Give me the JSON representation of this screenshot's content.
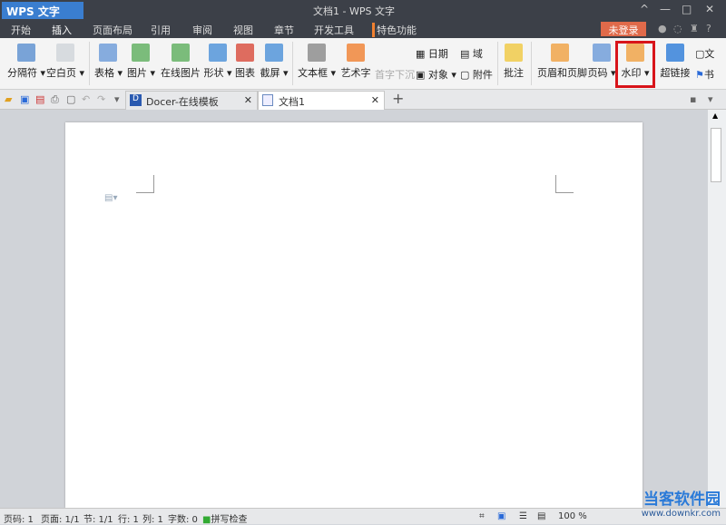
{
  "title_bar": {
    "app_button": "WPS 文字",
    "doc_title": "文档1 - WPS 文字",
    "controls": [
      "^",
      "—",
      "□",
      "✕"
    ]
  },
  "menu": {
    "tabs": [
      "开始",
      "插入",
      "页面布局",
      "引用",
      "审阅",
      "视图",
      "章节",
      "开发工具",
      "特色功能"
    ],
    "active": "插入",
    "login": "未登录",
    "help": "?"
  },
  "ribbon": {
    "large": [
      {
        "label": "分隔符 ▾",
        "color": "#5a8fd0"
      },
      {
        "label": "空白页 ▾",
        "color": "#cfd4da"
      },
      {
        "label": "表格 ▾",
        "color": "#6a9ad8"
      },
      {
        "label": "图片 ▾",
        "color": "#5cae5c"
      },
      {
        "label": "在线图片",
        "color": "#5cae5c"
      },
      {
        "label": "形状 ▾",
        "color": "#4a90d8"
      },
      {
        "label": "图表",
        "color": "#d84a3a"
      },
      {
        "label": "截屏 ▾",
        "color": "#4a90d8"
      },
      {
        "label": "文本框 ▾",
        "color": "#888888"
      },
      {
        "label": "艺术字",
        "color": "#f08030"
      },
      {
        "label": "批注",
        "color": "#f0c840"
      },
      {
        "label": "页眉和页脚",
        "color": "#f0a040"
      },
      {
        "label": "页码 ▾",
        "color": "#6a9ad8"
      },
      {
        "label": "水印 ▾",
        "color": "#f0a040"
      },
      {
        "label": "超链接",
        "color": "#2a7ad8"
      }
    ],
    "small": [
      "首字下沉",
      "日期",
      "对象 ▾",
      "域",
      "附件",
      "文",
      "书"
    ]
  },
  "tabs": {
    "docer": "Docer-在线模板",
    "doc": "文档1",
    "close": "✕",
    "add": "+"
  },
  "status": {
    "page": "页码: 1",
    "pages": "页面: 1/1",
    "section": "节: 1/1",
    "row": "行: 1",
    "col": "列: 1",
    "words": "字数: 0",
    "spell": "拼写检查",
    "zoom": "100 %"
  },
  "watermark": {
    "name": "当客软件园",
    "url": "www.downkr.com"
  }
}
